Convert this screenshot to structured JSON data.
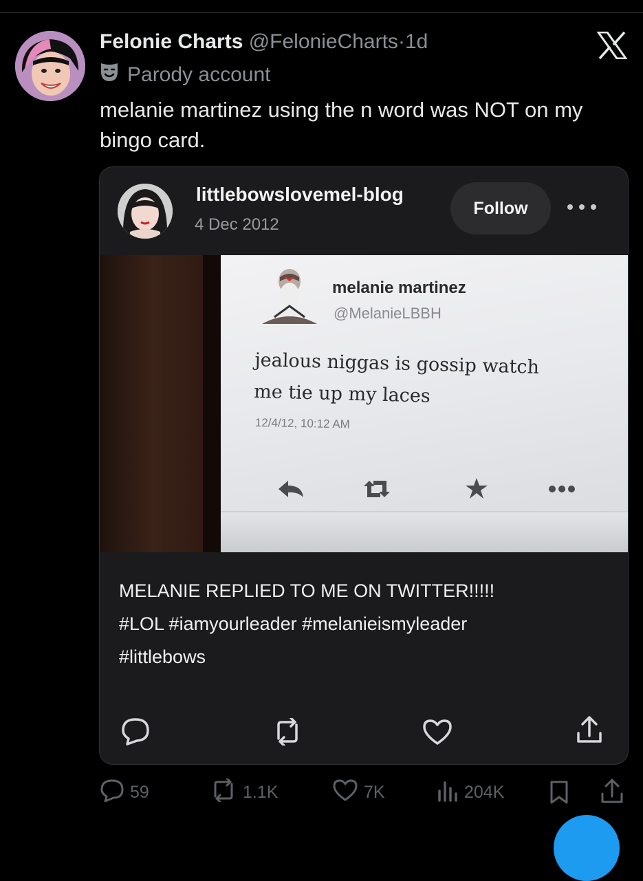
{
  "tweet": {
    "display_name": "Felonie Charts",
    "handle": "@FelonieCharts",
    "separator": "·",
    "time": "1d",
    "badge_label": "Parody account",
    "text": "melanie martinez using the n word was NOT on my bingo card."
  },
  "quoted_post": {
    "blog_name": "littlebowslovemel-blog",
    "date": "4 Dec 2012",
    "follow_label": "Follow",
    "embedded_tweet": {
      "name": "melanie martinez",
      "handle": "@MelanieLBBH",
      "text": "jealous niggas is gossip watch me tie up my laces",
      "timestamp": "12/4/12, 10:12 AM"
    },
    "caption_line1": "MELANIE REPLIED TO ME ON TWITTER!!!!!",
    "caption_line2": "#LOL #iamyourleader #melanieismyleader",
    "caption_line3": "#littlebows"
  },
  "stats": {
    "replies": "59",
    "reposts": "1.1K",
    "likes": "7K",
    "views": "204K"
  },
  "icons": {
    "close": "x-logo-icon",
    "parody": "theater-mask-icon",
    "more": "more-dots-icon",
    "reply": "reply-icon",
    "repost": "repost-icon",
    "like": "heart-icon",
    "share": "share-icon",
    "views": "views-icon",
    "bookmark": "bookmark-icon"
  },
  "colors": {
    "background": "#000000",
    "card": "#1b1b1d",
    "muted": "#8b9095",
    "accent": "#1d9bf0"
  }
}
